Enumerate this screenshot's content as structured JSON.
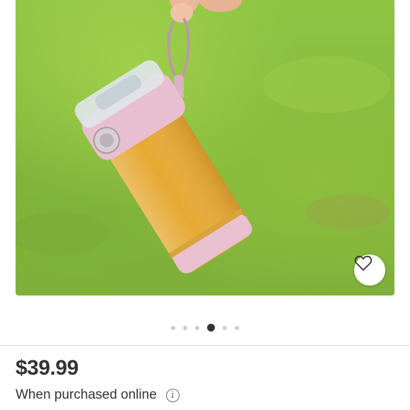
{
  "product": {
    "image_alt": "Blender bottle",
    "favorite_icon": "heart-outline-icon",
    "carousel": {
      "count": 6,
      "active_index": 3
    }
  },
  "pricing": {
    "price": "$39.99",
    "note": "When purchased online",
    "info_icon_glyph": "i"
  }
}
